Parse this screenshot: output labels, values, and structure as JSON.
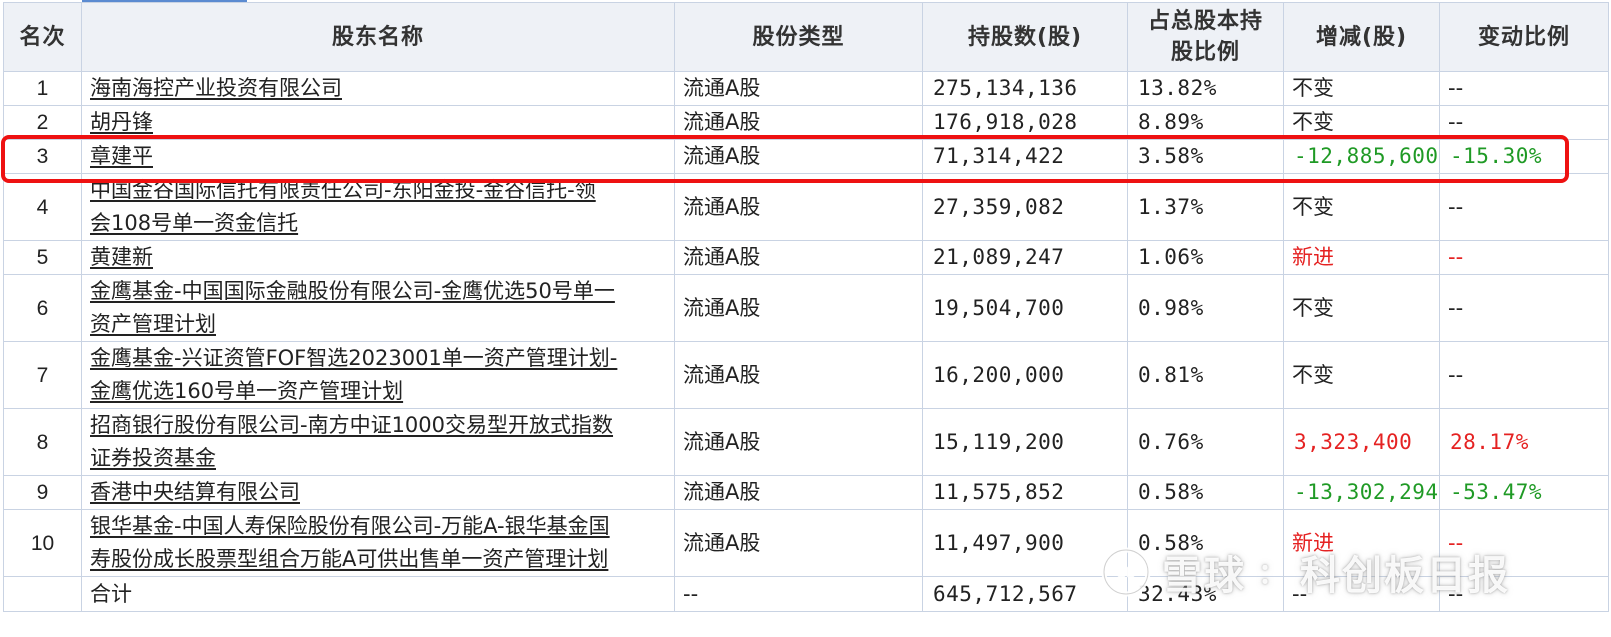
{
  "table": {
    "headers": {
      "rank": "名次",
      "name": "股东名称",
      "share_type": "股份类型",
      "shares": "持股数(股)",
      "pct_line1": "占总股本持",
      "pct_line2": "股比例",
      "change": "增减(股)",
      "change_ratio": "变动比例"
    },
    "rows": [
      {
        "rank": "1",
        "name": "海南海控产业投资有限公司",
        "share_type": "流通A股",
        "shares": "275,134,136",
        "pct": "13.82%",
        "change": "不变",
        "change_ratio": "--"
      },
      {
        "rank": "2",
        "name": "胡丹锋",
        "share_type": "流通A股",
        "shares": "176,918,028",
        "pct": "8.89%",
        "change": "不变",
        "change_ratio": "--"
      },
      {
        "rank": "3",
        "name": "章建平",
        "share_type": "流通A股",
        "shares": "71,314,422",
        "pct": "3.58%",
        "change": "-12,885,600",
        "change_ratio": "-15.30%"
      },
      {
        "rank": "4",
        "name_line1": "中国金谷国际信托有限责任公司-东阳金投-金谷信托-领",
        "name_line2": "会108号单一资金信托",
        "share_type": "流通A股",
        "shares": "27,359,082",
        "pct": "1.37%",
        "change": "不变",
        "change_ratio": "--"
      },
      {
        "rank": "5",
        "name": "黄建新",
        "share_type": "流通A股",
        "shares": "21,089,247",
        "pct": "1.06%",
        "change": "新进",
        "change_ratio": "--"
      },
      {
        "rank": "6",
        "name_line1": "金鹰基金-中国国际金融股份有限公司-金鹰优选50号单一",
        "name_line2": "资产管理计划",
        "share_type": "流通A股",
        "shares": "19,504,700",
        "pct": "0.98%",
        "change": "不变",
        "change_ratio": "--"
      },
      {
        "rank": "7",
        "name_line1": "金鹰基金-兴证资管FOF智选2023001单一资产管理计划-",
        "name_line2": "金鹰优选160号单一资产管理计划",
        "share_type": "流通A股",
        "shares": "16,200,000",
        "pct": "0.81%",
        "change": "不变",
        "change_ratio": "--"
      },
      {
        "rank": "8",
        "name_line1": "招商银行股份有限公司-南方中证1000交易型开放式指数",
        "name_line2": "证券投资基金",
        "share_type": "流通A股",
        "shares": "15,119,200",
        "pct": "0.76%",
        "change": "3,323,400",
        "change_ratio": "28.17%"
      },
      {
        "rank": "9",
        "name": "香港中央结算有限公司",
        "share_type": "流通A股",
        "shares": "11,575,852",
        "pct": "0.58%",
        "change": "-13,302,294",
        "change_ratio": "-53.47%"
      },
      {
        "rank": "10",
        "name_line1": "银华基金-中国人寿保险股份有限公司-万能A-银华基金国",
        "name_line2": "寿股份成长股票型组合万能A可供出售单一资产管理计划",
        "share_type": "流通A股",
        "shares": "11,497,900",
        "pct": "0.58%",
        "change": "新进",
        "change_ratio": "--"
      }
    ],
    "total": {
      "label": "合计",
      "share_type": "--",
      "shares": "645,712,567",
      "pct": "32.43%",
      "change": "--",
      "change_ratio": "--"
    }
  },
  "watermark": {
    "brand": "雪球",
    "separator": "：",
    "author": "科创板日报"
  },
  "colors": {
    "increase": "#e52222",
    "decrease": "#1f9a25",
    "highlight": "#ee1111",
    "header_bg": "#eef1f6",
    "border": "#c9d3e3"
  }
}
